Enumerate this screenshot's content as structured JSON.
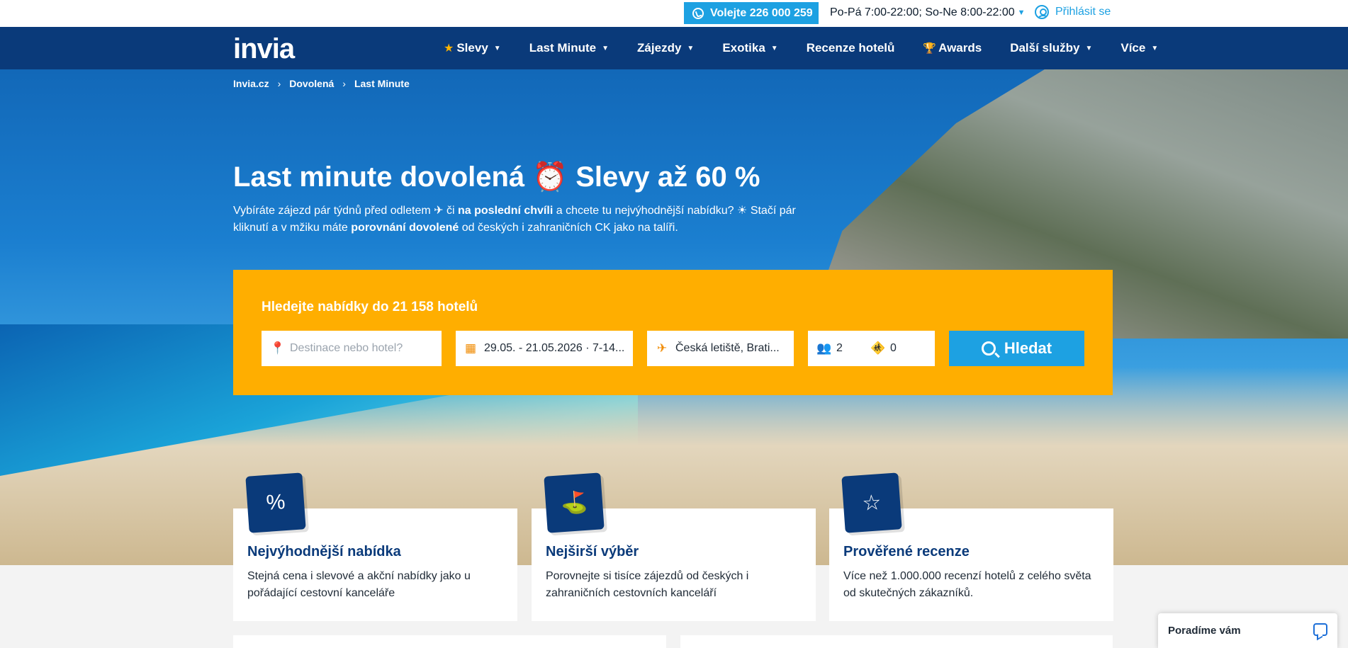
{
  "topbar": {
    "phone_label": "Volejte 226 000 259",
    "hours": "Po-Pá 7:00-22:00; So-Ne 8:00-22:00",
    "login_label": "Přihlásit se"
  },
  "nav": {
    "logo": "invia",
    "items": [
      {
        "label": "Slevy",
        "icon": "star-icon"
      },
      {
        "label": "Last Minute"
      },
      {
        "label": "Zájezdy"
      },
      {
        "label": "Exotika"
      },
      {
        "label": "Recenze hotelů"
      },
      {
        "label": "Awards",
        "icon": "trophy-icon"
      },
      {
        "label": "Další služby"
      },
      {
        "label": "Více"
      }
    ]
  },
  "breadcrumb": [
    "Invia.cz",
    "Dovolená",
    "Last Minute"
  ],
  "hero": {
    "title_part1": "Last minute dovolená",
    "title_emoji": "⏰",
    "title_part2": "Slevy až 60 %",
    "lead_1": "Vybíráte zájezd pár týdnů před odletem",
    "lead_plane": "✈",
    "lead_2": "či",
    "lead_bold_1": "na poslední chvíli",
    "lead_3": "a chcete tu nejvýhodnější nabídku?",
    "lead_sun": "☀",
    "lead_4": "Stačí pár kliknutí a v mžiku máte",
    "lead_bold_2": "porovnání dovolené",
    "lead_5": "od českých i zahraničních CK jako na talíři."
  },
  "search": {
    "title": "Hledejte nabídky do 21 158 hotelů",
    "destination_placeholder": "Destinace nebo hotel?",
    "dates": "29.05. - 21.05.2026 · 7-14...",
    "airports": "Česká letiště, Brati...",
    "adults": "2",
    "children": "0",
    "button": "Hledat"
  },
  "features": [
    {
      "title": "Nejvýhodnější nabídka",
      "text": "Stejná cena i slevové a akční nabídky jako u pořádající cestovní kanceláře",
      "icon": "percent-icon"
    },
    {
      "title": "Nejširší výběr",
      "text": "Porovnejte si tisíce zájezdů od českých i zahraničních cestovních kanceláří",
      "icon": "signpost-icon"
    },
    {
      "title": "Prověřené recenze",
      "text": "Více než 1.000.000 recenzí hotelů z celého světa od skutečných zákazníků.",
      "icon": "review-icon"
    }
  ],
  "chat": {
    "label": "Poradíme vám"
  }
}
